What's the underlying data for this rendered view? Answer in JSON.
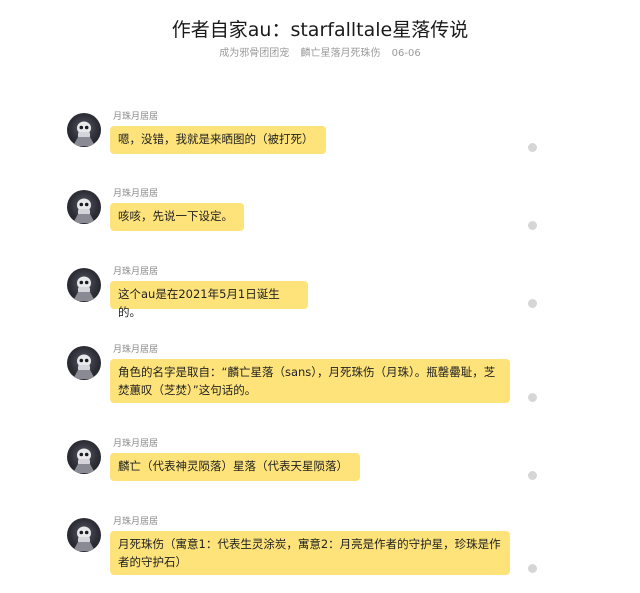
{
  "post": {
    "title": "作者自家au：starfalltale星落传说",
    "circle": "成为邪骨团团宠",
    "author": "麟亡星落月死珠伤",
    "date": "06-06"
  },
  "messages": [
    {
      "user": "月珠月居居",
      "text": "嗯，没错，我就是来晒图的（被打死）"
    },
    {
      "user": "月珠月居居",
      "text": "咳咳，先说一下设定。"
    },
    {
      "user": "月珠月居居",
      "text": "这个au是在2021年5月1日诞生的。"
    },
    {
      "user": "月珠月居居",
      "text": "角色的名字是取自：“麟亡星落（sans），月死珠伤（月珠）。瓶罄罍耻，芝焚蕙叹（芝焚）”这句话的。"
    },
    {
      "user": "月珠月居居",
      "text": "麟亡（代表神灵陨落）星落（代表天星陨落）"
    },
    {
      "user": "月珠月居居",
      "text": "月死珠伤（寓意1：代表生灵涂炭，寓意2：月亮是作者的守护星，珍珠是作者的守护石）"
    }
  ]
}
